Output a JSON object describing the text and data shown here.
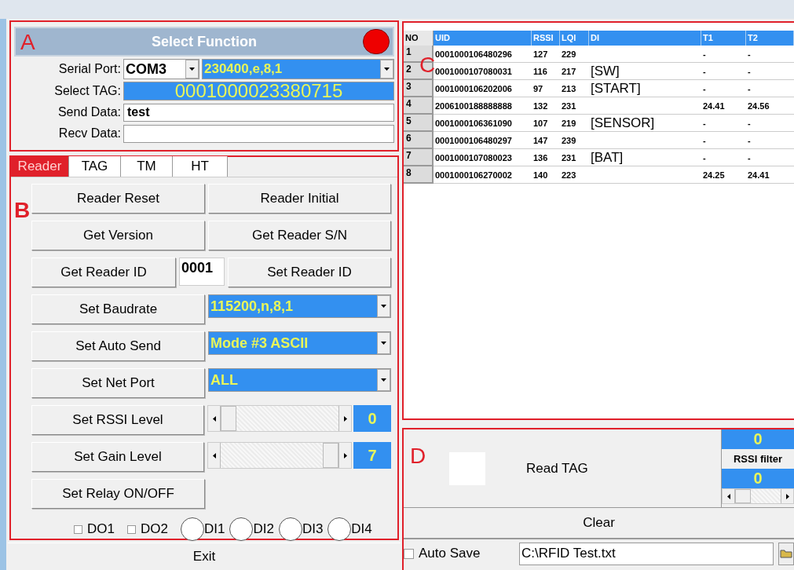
{
  "panel_a": {
    "label": "A",
    "title": "Select Function",
    "fields": [
      {
        "kind": "port",
        "label": "Serial Port:",
        "port": "COM3",
        "setting": "230400,e,8,1"
      },
      {
        "kind": "tag",
        "label": "Select TAG:",
        "value": "0001000023380715"
      },
      {
        "kind": "text",
        "label": "Send Data:",
        "value": "test"
      },
      {
        "kind": "text",
        "label": "Recv Data:"
      }
    ]
  },
  "panel_b": {
    "label": "B",
    "tabs": [
      {
        "label": "Reader",
        "selected": true
      },
      {
        "label": "TAG",
        "selected": false
      },
      {
        "label": "TM",
        "selected": false
      },
      {
        "label": "HT",
        "selected": false
      }
    ],
    "rows": [
      {
        "kind": "pair",
        "buttons": [
          "Reader Reset",
          "Reader Initial"
        ]
      },
      {
        "kind": "pair",
        "buttons": [
          "Get Version",
          "Get Reader S/N"
        ]
      },
      {
        "kind": "id",
        "buttons": [
          "Get Reader ID",
          "Set Reader ID"
        ],
        "value": "0001"
      },
      {
        "kind": "combo",
        "button": "Set Baudrate",
        "value": "115200,n,8,1"
      },
      {
        "kind": "combo",
        "button": "Set Auto Send",
        "value": "Mode #3 ASCII"
      },
      {
        "kind": "combo",
        "button": "Set Net Port",
        "value": "ALL"
      },
      {
        "kind": "slider",
        "button": "Set RSSI Level",
        "value": "0"
      },
      {
        "kind": "slider",
        "button": "Set Gain Level",
        "value": "7"
      },
      {
        "kind": "single",
        "button": "Set Relay ON/OFF"
      }
    ],
    "io": [
      {
        "kind": "checkbox",
        "label": "DO1",
        "checked": false
      },
      {
        "kind": "checkbox",
        "label": "DO2",
        "checked": false
      },
      {
        "kind": "indicator",
        "label": "DI1",
        "on": false
      },
      {
        "kind": "indicator",
        "label": "DI2",
        "on": false
      },
      {
        "kind": "indicator",
        "label": "DI3",
        "on": false
      },
      {
        "kind": "indicator",
        "label": "DI4",
        "on": false
      }
    ]
  },
  "exit_button": "Exit",
  "table": {
    "label": "C",
    "columns": [
      "NO",
      "UID",
      "RSSI",
      "LQI",
      "DI",
      "T1",
      "T2"
    ],
    "rows": [
      {
        "no": "1",
        "uid": "0001000106480296",
        "rssi": "127",
        "lqi": "229",
        "t1": "-",
        "t2": "-"
      },
      {
        "no": "2",
        "uid": "0001000107080031",
        "rssi": "116",
        "lqi": "217",
        "di": "[SW]",
        "t1": "-",
        "t2": "-"
      },
      {
        "no": "3",
        "uid": "0001000106202006",
        "rssi": "97",
        "lqi": "213",
        "di": "[START]",
        "t1": "-",
        "t2": "-"
      },
      {
        "no": "4",
        "uid": "2006100188888888",
        "rssi": "132",
        "lqi": "231",
        "t1": "24.41",
        "t2": "24.56"
      },
      {
        "no": "5",
        "uid": "0001000106361090",
        "rssi": "107",
        "lqi": "219",
        "di": "[SENSOR]",
        "t1": "-",
        "t2": "-"
      },
      {
        "no": "6",
        "uid": "0001000106480297",
        "rssi": "147",
        "lqi": "239",
        "t1": "-",
        "t2": "-"
      },
      {
        "no": "7",
        "uid": "0001000107080023",
        "rssi": "136",
        "lqi": "231",
        "di": "[BAT]",
        "t1": "-",
        "t2": "-"
      },
      {
        "no": "8",
        "uid": "0001000106270002",
        "rssi": "140",
        "lqi": "223",
        "t1": "24.25",
        "t2": "24.41"
      }
    ]
  },
  "panel_d": {
    "label": "D",
    "read_button": "Read TAG",
    "rssi_filter": {
      "upper": "0",
      "label": "RSSI filter",
      "lower": "0"
    },
    "clear_button": "Clear",
    "auto_save": {
      "label": "Auto Save",
      "checked": false
    },
    "path": "C:\\RFID Test.txt"
  }
}
